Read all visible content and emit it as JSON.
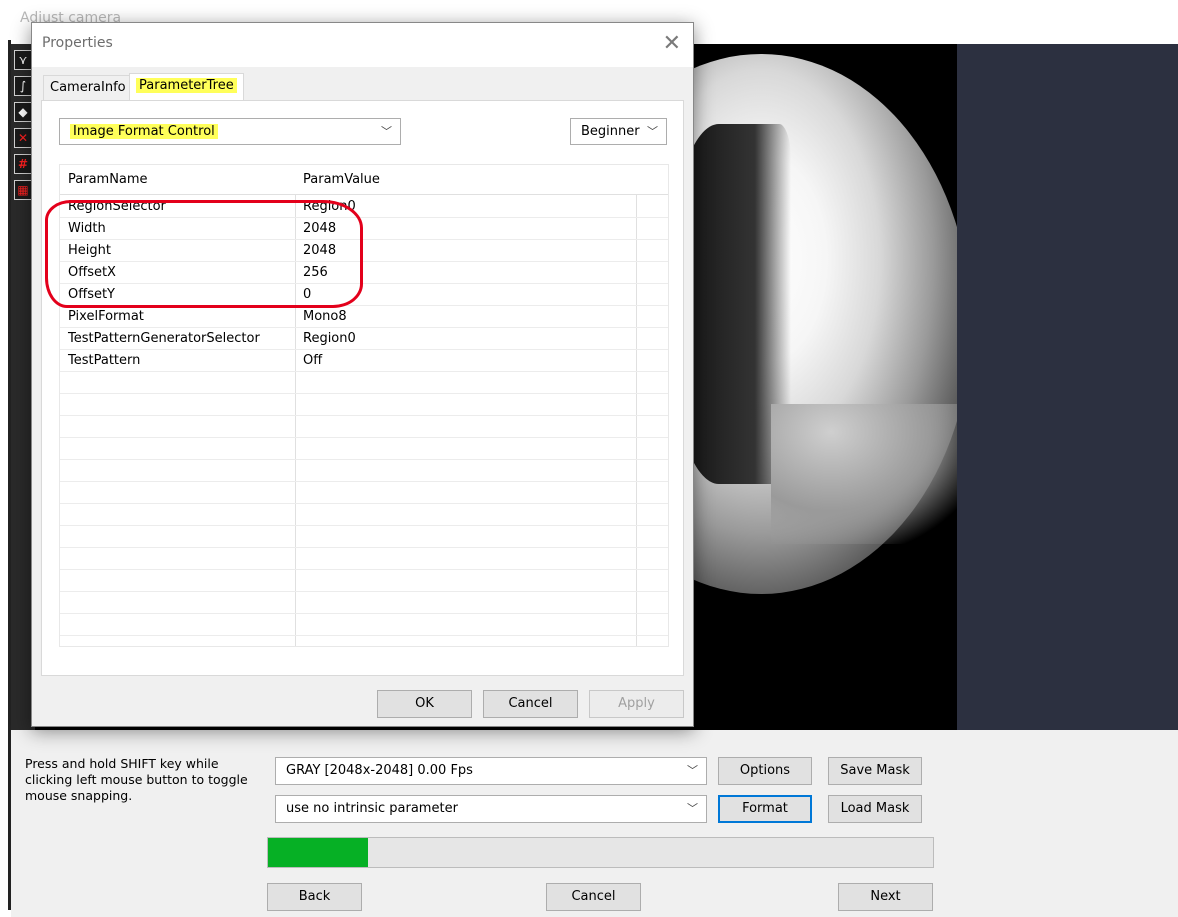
{
  "main": {
    "title": "Adjust camera",
    "hint_text": "Press and hold SHIFT key while clicking left mouse button to toggle mouse snapping.",
    "format_combo": "GRAY  [2048x-2048]  0.00 Fps",
    "intrinsic_combo": "use no intrinsic parameter",
    "options_label": "Options",
    "format_label": "Format",
    "save_mask_label": "Save Mask",
    "load_mask_label": "Load Mask",
    "back_label": "Back",
    "cancel_label": "Cancel",
    "next_label": "Next",
    "progress_percent": 15,
    "progress_color": "#06b025"
  },
  "toolbar": {
    "icons": [
      "polyline-tool-icon",
      "curve-tool-icon",
      "fill-tool-icon",
      "delete-icon",
      "grid-icon",
      "grid-select-icon"
    ]
  },
  "dialog": {
    "title": "Properties",
    "tabs": [
      "CameraInfo",
      "ParameterTree"
    ],
    "active_tab": "ParameterTree",
    "category_select": "Image Format Control",
    "level_select": "Beginner",
    "columns": [
      "ParamName",
      "ParamValue"
    ],
    "rows": [
      {
        "name": "RegionSelector",
        "value": "Region0"
      },
      {
        "name": "Width",
        "value": "2048"
      },
      {
        "name": "Height",
        "value": "2048"
      },
      {
        "name": "OffsetX",
        "value": "256"
      },
      {
        "name": "OffsetY",
        "value": "0"
      },
      {
        "name": "PixelFormat",
        "value": "Mono8"
      },
      {
        "name": "TestPatternGeneratorSelector",
        "value": "Region0"
      },
      {
        "name": "TestPattern",
        "value": "Off"
      }
    ],
    "ok_label": "OK",
    "cancel_label": "Cancel",
    "apply_label": "Apply",
    "highlight_color": "#ffff5a",
    "annotation_color": "#e3001b"
  }
}
